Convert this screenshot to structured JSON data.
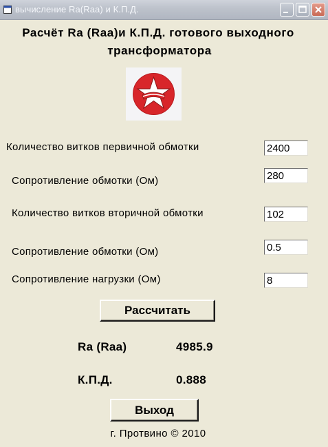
{
  "window": {
    "title": "вычисление Ra(Raa) и К.П.Д."
  },
  "heading": {
    "line1": "Расчёт Ra (Raa)и К.П.Д. готового выходного",
    "line2": "трансформатора"
  },
  "form": {
    "primary_turns_label": "Количество витков первичной обмотки",
    "primary_turns_value": "2400",
    "primary_resistance_label": "Сопротивление обмотки (Ом)",
    "primary_resistance_value": "280",
    "secondary_turns_label": "Количество витков вторичной обмотки",
    "secondary_turns_value": "102",
    "secondary_resistance_label": "Сопротивление обмотки (Ом)",
    "secondary_resistance_value": "0.5",
    "load_resistance_label": "Сопротивление нагрузки (Ом)",
    "load_resistance_value": "8"
  },
  "buttons": {
    "calculate": "Рассчитать",
    "exit": "Выход"
  },
  "results": {
    "ra_label": "Ra (Raa)",
    "ra_value": "4985.9",
    "efficiency_label": "К.П.Д.",
    "efficiency_value": "0.888"
  },
  "footer": "г. Протвино © 2010",
  "icons": {
    "app": "window-app-icon",
    "logo": "red-star-emblem-icon",
    "minimize": "minimize-icon",
    "maximize": "maximize-icon",
    "close": "close-icon"
  },
  "colors": {
    "window_bg": "#ece9d8",
    "logo_red": "#d8262a"
  }
}
